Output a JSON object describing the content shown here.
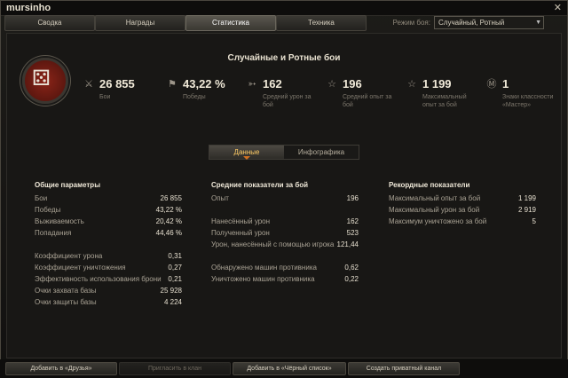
{
  "window": {
    "title": "mursinho",
    "close": "✕"
  },
  "tabs": [
    {
      "label": "Сводка",
      "active": false
    },
    {
      "label": "Награды",
      "active": false
    },
    {
      "label": "Статистика",
      "active": true
    },
    {
      "label": "Техника",
      "active": false
    }
  ],
  "mode": {
    "label": "Режим боя:",
    "value": "Случайный, Ротный"
  },
  "header": {
    "title": "Случайные и Ротные бои",
    "stats": [
      {
        "icon": "crossed-swords-icon",
        "glyph": "⚔",
        "value": "26 855",
        "label": "Бои"
      },
      {
        "icon": "flag-icon",
        "glyph": "⚑",
        "value": "43,22 %",
        "label": "Победы"
      },
      {
        "icon": "shell-icon",
        "glyph": "➳",
        "value": "162",
        "label": "Средний урон за бой"
      },
      {
        "icon": "star-outline-icon",
        "glyph": "☆",
        "value": "196",
        "label": "Средний опыт за бой"
      },
      {
        "icon": "star-icon",
        "glyph": "☆",
        "value": "1 199",
        "label": "Максимальный опыт за бой"
      },
      {
        "icon": "master-badge-icon",
        "glyph": "Ⓜ",
        "value": "1",
        "label": "Знаки классности «Мастер»"
      }
    ]
  },
  "view_toggle": {
    "data": "Данные",
    "infographic": "Инфографика"
  },
  "general": {
    "title": "Общие параметры",
    "rows": [
      {
        "label": "Бои",
        "value": "26 855"
      },
      {
        "label": "Победы",
        "value": "43,22 %"
      },
      {
        "label": "Выживаемость",
        "value": "20,42 %"
      },
      {
        "label": "Попадания",
        "value": "44,46 %"
      },
      {
        "label": "Коэффициент урона",
        "value": "0,31"
      },
      {
        "label": "Коэффициент уничтожения",
        "value": "0,27"
      },
      {
        "label": "Эффективность использования брони",
        "value": "0,21"
      },
      {
        "label": "Очки захвата базы",
        "value": "25 928"
      },
      {
        "label": "Очки защиты базы",
        "value": "4 224"
      }
    ]
  },
  "average": {
    "title": "Средние показатели за бой",
    "rows": [
      {
        "label": "Опыт",
        "value": "196"
      },
      {
        "label": "Нанесённый урон",
        "value": "162"
      },
      {
        "label": "Полученный урон",
        "value": "523"
      },
      {
        "label": "Урон, нанесённый с помощью игрока",
        "value": "121,44"
      },
      {
        "label": "Обнаружено машин противника",
        "value": "0,62"
      },
      {
        "label": "Уничтожено машин противника",
        "value": "0,22"
      }
    ]
  },
  "records": {
    "title": "Рекордные показатели",
    "rows": [
      {
        "label": "Максимальный опыт за бой",
        "value": "1 199"
      },
      {
        "label": "Максимальный урон за бой",
        "value": "2 919"
      },
      {
        "label": "Максимум уничтожено за бой",
        "value": "5"
      }
    ]
  },
  "footer": {
    "add_friend": "Добавить в «Друзья»",
    "invite_clan": "Пригласить в клан",
    "add_blacklist": "Добавить в «Чёрный список»",
    "create_channel": "Создать приватный канал"
  }
}
